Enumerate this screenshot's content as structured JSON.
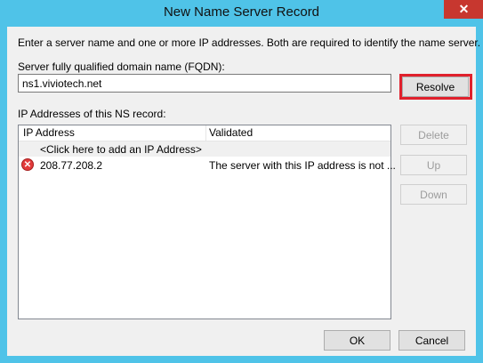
{
  "window": {
    "title": "New Name Server Record",
    "close_label": "✕"
  },
  "dialog": {
    "instructions": "Enter a server name and one or more IP addresses.  Both are required to identify the name server.",
    "fqdn_label": "Server fully qualified domain name (FQDN):",
    "fqdn_value": "ns1.viviotech.net",
    "resolve_label": "Resolve",
    "ip_section_label": "IP Addresses of this NS record:",
    "columns": [
      "IP Address",
      "Validated"
    ],
    "add_row_text": "<Click here to add an IP Address>",
    "rows": [
      {
        "icon": "error-icon",
        "ip": "208.77.208.2",
        "validated": "The server with this IP address is not ..."
      }
    ],
    "delete_label": "Delete",
    "up_label": "Up",
    "down_label": "Down",
    "ok_label": "OK",
    "cancel_label": "Cancel"
  },
  "colors": {
    "frame": "#4fc3e8",
    "close_button": "#c7372f",
    "highlight": "#e0202c",
    "error_icon": "#e23b3b"
  }
}
